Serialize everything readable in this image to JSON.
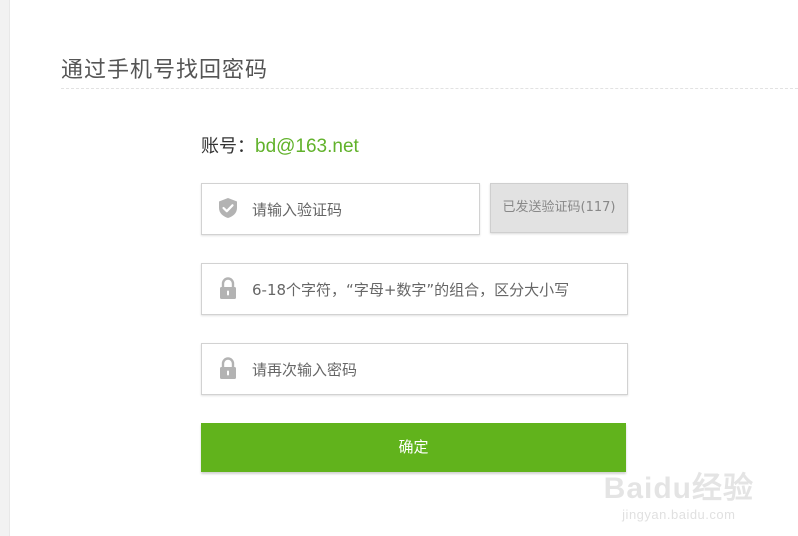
{
  "page": {
    "title": "通过手机号找回密码"
  },
  "account": {
    "label": "账号：",
    "value": "bd@163.net"
  },
  "form": {
    "code_placeholder": "请输入验证码",
    "send_button_label": "已发送验证码(117)",
    "password_placeholder": "6-18个字符，“字母+数字”的组合，区分大小写",
    "password_confirm_placeholder": "请再次输入密码",
    "confirm_button_label": "确定"
  },
  "icons": {
    "code_field": "shield-check-icon",
    "password_field": "lock-icon",
    "password_confirm_field": "lock-icon"
  },
  "colors": {
    "accent_green": "#61b31c",
    "account_green": "#61b22b",
    "icon_gray": "#b3b3b3",
    "disabled_button_bg": "#e2e2e2"
  },
  "watermark": {
    "logo": "Baidu经验",
    "url": "jingyan.baidu.com"
  }
}
